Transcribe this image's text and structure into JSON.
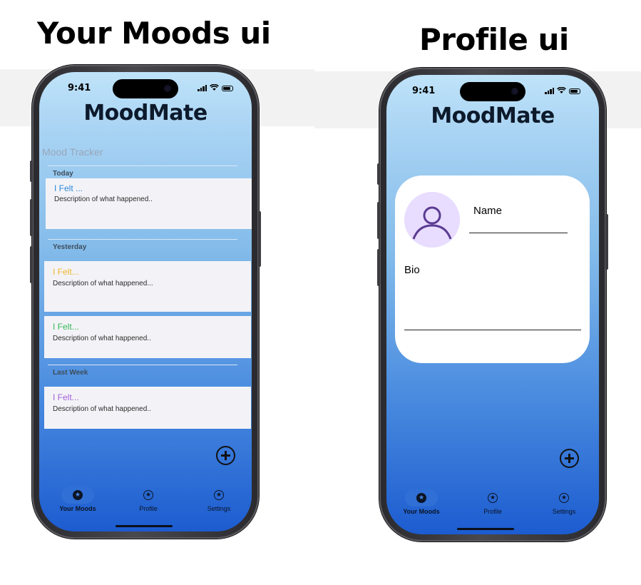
{
  "screens": {
    "moods": {
      "heading": "Your Moods ui",
      "status_time": "9:41",
      "app_title": "MoodMate",
      "section_title": "Mood Tracker",
      "sections": [
        {
          "label": "Today",
          "entries": [
            {
              "felt": "I Felt ...",
              "description": "Description of what happened..",
              "color": "#2c88dc"
            }
          ]
        },
        {
          "label": "Yesterday",
          "entries": [
            {
              "felt": "I Felt...",
              "description": "Description of what happened...",
              "color": "#f0b52c"
            },
            {
              "felt": "I Felt...",
              "description": "Description of what happened..",
              "color": "#34b757"
            }
          ]
        },
        {
          "label": "Last Week",
          "entries": [
            {
              "felt": "I Felt...",
              "description": "Description of what happened..",
              "color": "#a461d8"
            }
          ]
        }
      ],
      "fab_icon": "add-circle-icon"
    },
    "profile": {
      "heading": "Profile ui",
      "status_time": "9:41",
      "app_title": "MoodMate",
      "name_label": "Name",
      "bio_label": "Bio",
      "avatar_icon": "person-icon",
      "fab_icon": "add-circle-icon"
    }
  },
  "nav": {
    "items": [
      {
        "label": "Your Moods",
        "icon": "star-icon",
        "active": true
      },
      {
        "label": "Profile",
        "icon": "star-icon",
        "active": false
      },
      {
        "label": "Settings",
        "icon": "star-icon",
        "active": false
      }
    ],
    "icon_glyph": "★"
  },
  "colors": {
    "gradient_top": "#bfe3f9",
    "gradient_bottom": "#1c5cd0",
    "card_bg": "#f3f3f7",
    "avatar_bg": "#e8dcff",
    "avatar_stroke": "#5a3b91"
  }
}
